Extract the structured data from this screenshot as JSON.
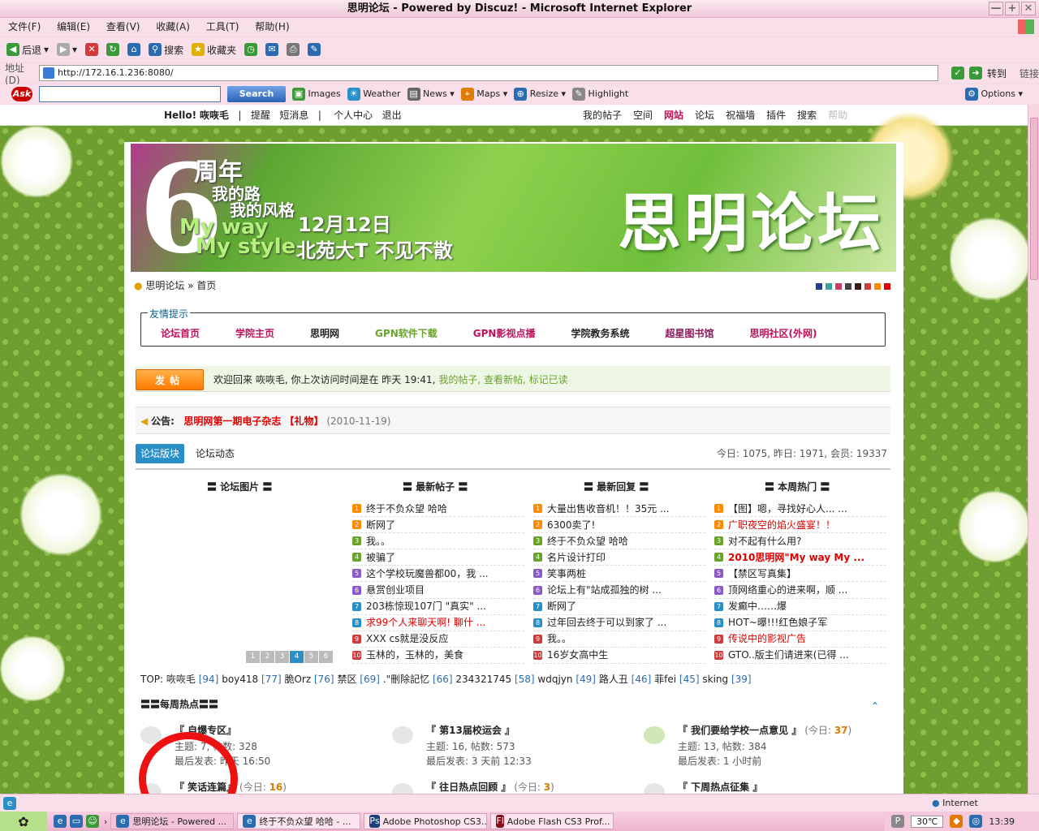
{
  "window": {
    "title": "思明论坛 - Powered by Discuz! - Microsoft Internet Explorer",
    "min": "—",
    "max": "+",
    "close": "✕"
  },
  "menu": [
    "文件(F)",
    "编辑(E)",
    "查看(V)",
    "收藏(A)",
    "工具(T)",
    "帮助(H)"
  ],
  "toolbar": {
    "back": "后退",
    "search": "搜索",
    "favorites": "收藏夹"
  },
  "address": {
    "label": "地址(D)",
    "url": "http://172.16.1.236:8080/",
    "go": "转到",
    "links": "链接"
  },
  "askbar": {
    "logo": "Ask",
    "search_btn": "Search",
    "items": [
      "Images",
      "Weather",
      "News",
      "Maps",
      "Resize",
      "Highlight"
    ],
    "options": "Options"
  },
  "topnav": {
    "hello": "Hello!",
    "user": "咴咴毛",
    "left": [
      "提醒",
      "短消息",
      "个人中心",
      "退出"
    ],
    "right": [
      "我的帖子",
      "空间",
      "网站",
      "论坛",
      "祝福墙",
      "插件",
      "搜索",
      "帮助"
    ]
  },
  "banner": {
    "big": "6",
    "line1": "周年",
    "line2": "我的路",
    "line3": "我的风格",
    "line4": "My way",
    "line5": "My style",
    "line6": "12月12日",
    "line7": "北苑大T 不见不散",
    "logo": "思明论坛"
  },
  "crumb": {
    "home": "思明论坛",
    "sep": "»",
    "page": "首页"
  },
  "swatches": [
    "#1f3f8f",
    "#3aa0a0",
    "#d03a6a",
    "#444444",
    "#3a1a1a",
    "#d03a3a",
    "#ff8a00",
    "#e00000"
  ],
  "notice": {
    "caption": "友情提示",
    "links": [
      {
        "t": "论坛首页",
        "c": "#c0105a"
      },
      {
        "t": "学院主页",
        "c": "#c0105a"
      },
      {
        "t": "思明网",
        "c": "#222222"
      },
      {
        "t": "GPN软件下载",
        "c": "#6aa32a"
      },
      {
        "t": "GPN影视点播",
        "c": "#c0105a"
      },
      {
        "t": "学院教务系统",
        "c": "#222222"
      },
      {
        "t": "超星图书馆",
        "c": "#8a1a5a"
      },
      {
        "t": "思明社区(外网)",
        "c": "#c0105a"
      }
    ]
  },
  "welcome": {
    "post_btn": "发帖",
    "text": "欢迎回来 咴咴毛, 你上次访问时间是在 昨天 19:41,",
    "links": "我的帖子, 查看新帖, 标记已读"
  },
  "announce": {
    "label": "公告:",
    "title": "思明网第一期电子杂志 【礼物】",
    "date": "(2010-11-19)"
  },
  "tabs": {
    "t1": "论坛版块",
    "t2": "论坛动态",
    "stats": "今日: 1075, 昨日: 1971, 会员: 19337"
  },
  "columns": {
    "h1": "〓 论坛图片 〓",
    "h2": "〓 最新帖子 〓",
    "h3": "〓 最新回复 〓",
    "h4": "〓 本周热门 〓",
    "newest": [
      {
        "t": "终于不负众望 哈哈"
      },
      {
        "t": "断网了"
      },
      {
        "t": "我。。"
      },
      {
        "t": "被骗了"
      },
      {
        "t": "这个学校玩魔兽都00，我 ..."
      },
      {
        "t": "悬赏创业项目"
      },
      {
        "t": "203栋惊现107门 \"真实\" ..."
      },
      {
        "t": "求99个人来聊天啊! 聊什 ...",
        "red": true
      },
      {
        "t": "XXX cs就是没反应"
      },
      {
        "t": "玉林的，玉林的，美食"
      }
    ],
    "replies": [
      {
        "t": "大量出售收音机！！35元 ..."
      },
      {
        "t": "6300卖了!"
      },
      {
        "t": "终于不负众望 哈哈"
      },
      {
        "t": "名片设计打印"
      },
      {
        "t": "笑事两桩"
      },
      {
        "t": "论坛上有\"站成孤独的树 ..."
      },
      {
        "t": "断网了"
      },
      {
        "t": "过年回去终于可以到家了 ..."
      },
      {
        "t": "我。。"
      },
      {
        "t": "16岁女高中生"
      }
    ],
    "hot": [
      {
        "t": "【图】嗯，寻找好心人... ..."
      },
      {
        "t": "广职夜空的焰火盛宴！！",
        "red": true
      },
      {
        "t": "对不起有什么用?"
      },
      {
        "t": "2010思明网\"My way My ...",
        "red": true,
        "bold": true
      },
      {
        "t": "【禁区写真集】"
      },
      {
        "t": "顶网络重心的进来啊，顺 ..."
      },
      {
        "t": "发癫中……爆"
      },
      {
        "t": "HOT~曝!!!红色娘子军"
      },
      {
        "t": "传说中的影视广告",
        "red": true
      },
      {
        "t": "GTO..版主们请进来(已得 ..."
      }
    ],
    "num_colors": [
      "#ff8a00",
      "#ff8a00",
      "#6aa32a",
      "#6aa32a",
      "#8a5ac8",
      "#8a5ac8",
      "#2b8fc7",
      "#2b8fc7",
      "#d03a3a",
      "#d03a3a"
    ]
  },
  "pager": [
    "1",
    "2",
    "3",
    "4",
    "5",
    "6"
  ],
  "topline": [
    {
      "n": "咴咴毛",
      "v": "[94]"
    },
    {
      "n": "boy418",
      "v": "[77]"
    },
    {
      "n": "脆Orz",
      "v": "[76]"
    },
    {
      "n": "禁区",
      "v": "[69]"
    },
    {
      "n": ".\"刪除記忆",
      "v": "[66]"
    },
    {
      "n": "234321745",
      "v": "[58]"
    },
    {
      "n": "wdqjyn",
      "v": "[49]"
    },
    {
      "n": "路人丑",
      "v": "[46]"
    },
    {
      "n": "菲fei",
      "v": "[45]"
    },
    {
      "n": "sking",
      "v": "[39]"
    }
  ],
  "topline_prefix": "TOP:",
  "hot_header": "〓〓每周热点〓〓",
  "hot_boards": [
    {
      "title": "『 自爆专区』",
      "today": "",
      "sub1": "主题: 7, 帖数: 328",
      "sub2": "最后发表: 昨天 16:50"
    },
    {
      "title": "『 第13届校运会 』",
      "today": "",
      "sub1": "主题: 16, 帖数: 573",
      "sub2": "最后发表: 3 天前 12:33"
    },
    {
      "title": "『 我们要给学校一点意见 』",
      "today": "37",
      "sub1": "主题: 13, 帖数: 384",
      "sub2": "最后发表: 1 小时前"
    },
    {
      "title": "『 笑话连篇』",
      "today": "16",
      "sub1": "",
      "sub2": ""
    },
    {
      "title": "『 往日热点回顾 』",
      "today": "3",
      "sub1": "",
      "sub2": ""
    },
    {
      "title": "『 下周热点征集 』",
      "today": "",
      "sub1": "",
      "sub2": ""
    }
  ],
  "today_label": "(今日:",
  "status": {
    "zone": "Internet"
  },
  "taskbar": {
    "tasks": [
      "思明论坛 - Powered ...",
      "终于不负众望 哈哈 - ...",
      "Adobe Photoshop CS3...",
      "Adobe Flash CS3 Prof..."
    ],
    "temp": "30℃",
    "time": "13:39"
  }
}
